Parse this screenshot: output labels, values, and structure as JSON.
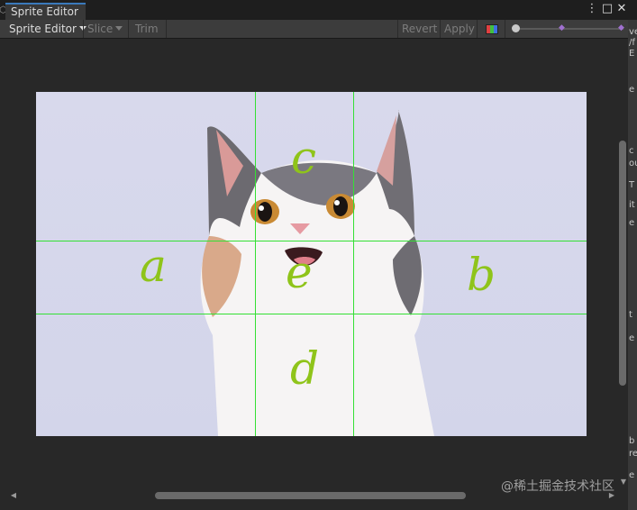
{
  "window": {
    "tab_label": "Sprite Editor",
    "controls": [
      "⋮",
      "□",
      "✕"
    ]
  },
  "toolbar": {
    "mode_label": "Sprite Editor",
    "slice_label": "Slice",
    "trim_label": "Trim",
    "revert_label": "Revert",
    "apply_label": "Apply"
  },
  "annotations": {
    "top": "c",
    "left": "a",
    "center": "e",
    "right": "b",
    "bottom": "d"
  },
  "right_panel_letters": [
    "ve",
    "/f",
    "E",
    "e",
    "c",
    "ou",
    "T",
    "it",
    "e",
    "t",
    "e",
    "b",
    "re",
    "e"
  ],
  "watermark": "@稀土掘金技术社区",
  "colors": {
    "guide": "#34e034",
    "annotation": "#8fc41a",
    "tab_accent": "#3a79bb"
  }
}
